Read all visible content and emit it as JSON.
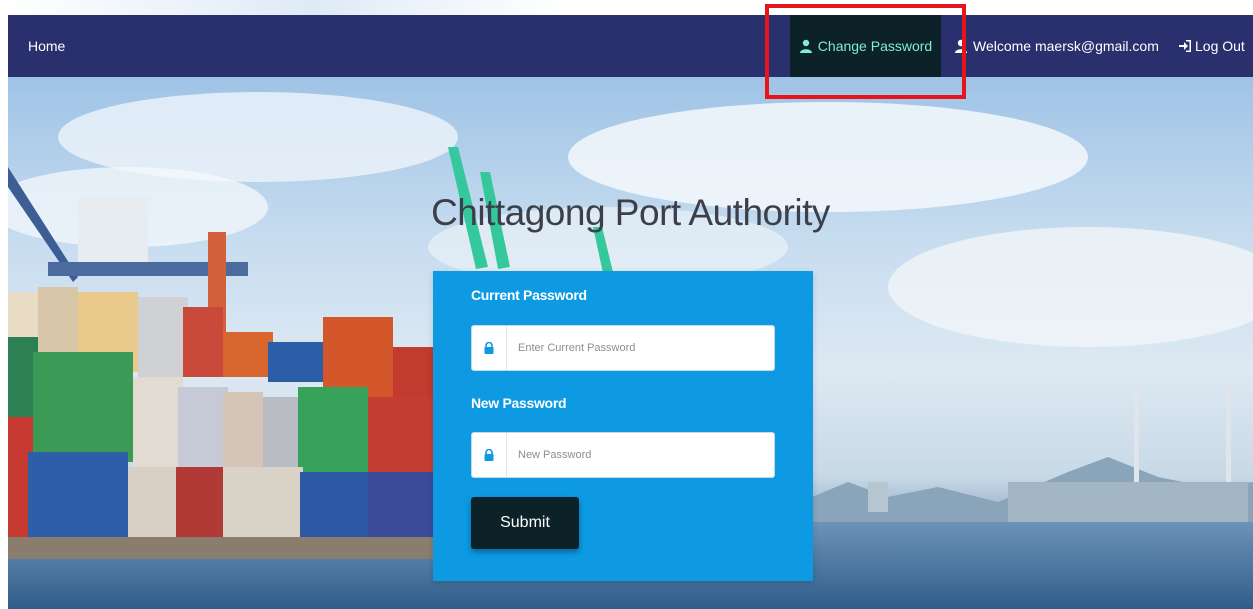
{
  "nav": {
    "home_label": "Home",
    "change_password_label": "Change Password",
    "welcome_label": "Welcome maersk@gmail.com",
    "logout_label": "Log Out"
  },
  "hero": {
    "title": "Chittagong Port Authority"
  },
  "form": {
    "current_password_label": "Current Password",
    "current_password_placeholder": "Enter Current Password",
    "current_password_value": "",
    "new_password_label": "New Password",
    "new_password_placeholder": "New Password",
    "new_password_value": "",
    "submit_label": "Submit"
  },
  "icons": {
    "change_password": "user-icon",
    "welcome": "user-icon",
    "logout": "sign-in-icon",
    "field_lock": "lock-icon"
  },
  "colors": {
    "navbar": "#2a2f6e",
    "active_nav_bg": "#0c2228",
    "active_nav_text": "#7df0cf",
    "card": "#0d9ae3",
    "submit": "#0c2228",
    "highlight": "#e6141b"
  }
}
